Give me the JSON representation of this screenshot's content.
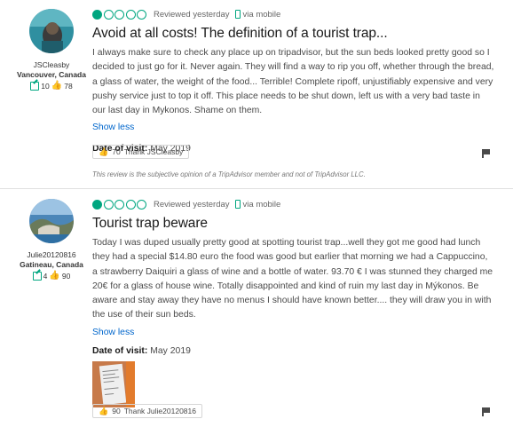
{
  "reviews": [
    {
      "member": {
        "username": "JSCleasby",
        "location": "Vancouver, Canada",
        "review_count": "10",
        "helpful_count": "78"
      },
      "rating": 1,
      "reviewed_date": "Reviewed yesterday",
      "via": "via mobile",
      "title": "Avoid at all costs! The definition of a tourist trap...",
      "body": "I always make sure to check any place up on tripadvisor, but the sun beds looked pretty good so I decided to just go for it. Never again. They will find a way to rip you off, whether through the bread, a glass of water, the weight of the food... Terrible! Complete ripoff, unjustifiably expensive and very pushy service just to top it off. This place needs to be shut down, left us with a very bad taste in our last day in Mykonos. Shame on them.",
      "show_less": "Show less",
      "date_of_visit_label": "Date of visit:",
      "date_of_visit": "May 2019",
      "thanks_count": "70",
      "thank_label": "Thank JSCleasby",
      "disclaimer": "This review is the subjective opinion of a TripAdvisor member and not of TripAdvisor LLC."
    },
    {
      "member": {
        "username": "Julie20120816",
        "location": "Gatineau, Canada",
        "review_count": "4",
        "helpful_count": "90"
      },
      "rating": 1,
      "reviewed_date": "Reviewed yesterday",
      "via": "via mobile",
      "title": "Tourist trap beware",
      "body": "Today I was duped usually pretty good at spotting tourist trap...well they got me good had lunch they had a special $14.80 euro the food was good but earlier that morning we had a Cappuccino, a strawberry Daiquiri a glass of wine and a bottle of water. 93.70 € I was stunned they charged me 20€ for a glass of house wine. Totally disappointed and kind of ruin my last day in Mýkonos. Be aware and stay away they have no menus I should have known better.... they will draw you in with the use of their sun beds.",
      "show_less": "Show less",
      "date_of_visit_label": "Date of visit:",
      "date_of_visit": "May 2019",
      "thanks_count": "90",
      "thank_label": "Thank Julie20120816"
    }
  ],
  "colors": {
    "accent": "#00a680",
    "link": "#0066cc"
  }
}
